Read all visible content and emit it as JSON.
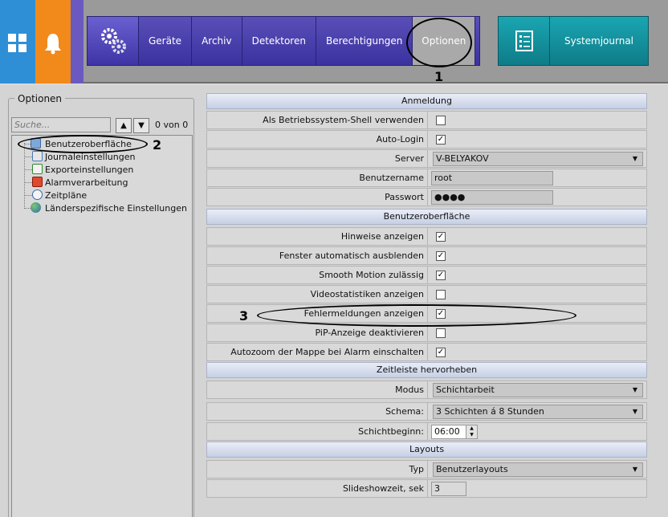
{
  "topbar": {
    "nav": [
      "Geräte",
      "Archiv",
      "Detektoren",
      "Berechtigungen",
      "Optionen"
    ],
    "selected": "Optionen",
    "system_label": "Systemjournal",
    "icons": [
      "windows-icon",
      "bell-icon",
      "gears-icon",
      "checklist-icon"
    ]
  },
  "callouts": {
    "one": "1",
    "two": "2",
    "three": "3"
  },
  "left": {
    "group_title": "Optionen",
    "search_placeholder": "Suche...",
    "count": "0 von 0",
    "tree": [
      "Benutzeroberfläche",
      "Journaleinstellungen",
      "Exporteinstellungen",
      "Alarmverarbeitung",
      "Zeitpläne",
      "Länderspezifische Einstellungen"
    ]
  },
  "right": {
    "sections": {
      "anmeldung": "Anmeldung",
      "ui": "Benutzeroberfläche",
      "zeit": "Zeitleiste hervorheben",
      "layouts": "Layouts"
    },
    "anmeldung": {
      "shell": "Als Betriebssystem-Shell verwenden",
      "autologin": "Auto-Login",
      "server": "Server",
      "server_value": "V-BELYAKOV",
      "user": "Benutzername",
      "user_value": "root",
      "pass": "Passwort",
      "pass_value": "●●●●"
    },
    "ui": {
      "hints": "Hinweise anzeigen",
      "autohide": "Fenster automatisch ausblenden",
      "smooth": "Smooth Motion zulässig",
      "videostat": "Videostatistiken anzeigen",
      "errors": "Fehlermeldungen anzeigen",
      "pip": "PiP-Anzeige deaktivieren",
      "autozoom": "Autozoom der Mappe bei Alarm einschalten"
    },
    "zeit": {
      "modus": "Modus",
      "modus_value": "Schichtarbeit",
      "schema": "Schema:",
      "schema_value": "3 Schichten á 8 Stunden",
      "beginn": "Schichtbeginn:",
      "beginn_value": "06:00"
    },
    "layouts": {
      "typ": "Typ",
      "typ_value": "Benutzerlayouts",
      "slide": "Slideshowzeit, sek",
      "slide_value": "3"
    },
    "checks": {
      "shell": false,
      "autologin": true,
      "hints": true,
      "autohide": true,
      "smooth": true,
      "videostat": false,
      "errors": true,
      "pip": false,
      "autozoom": true
    }
  }
}
